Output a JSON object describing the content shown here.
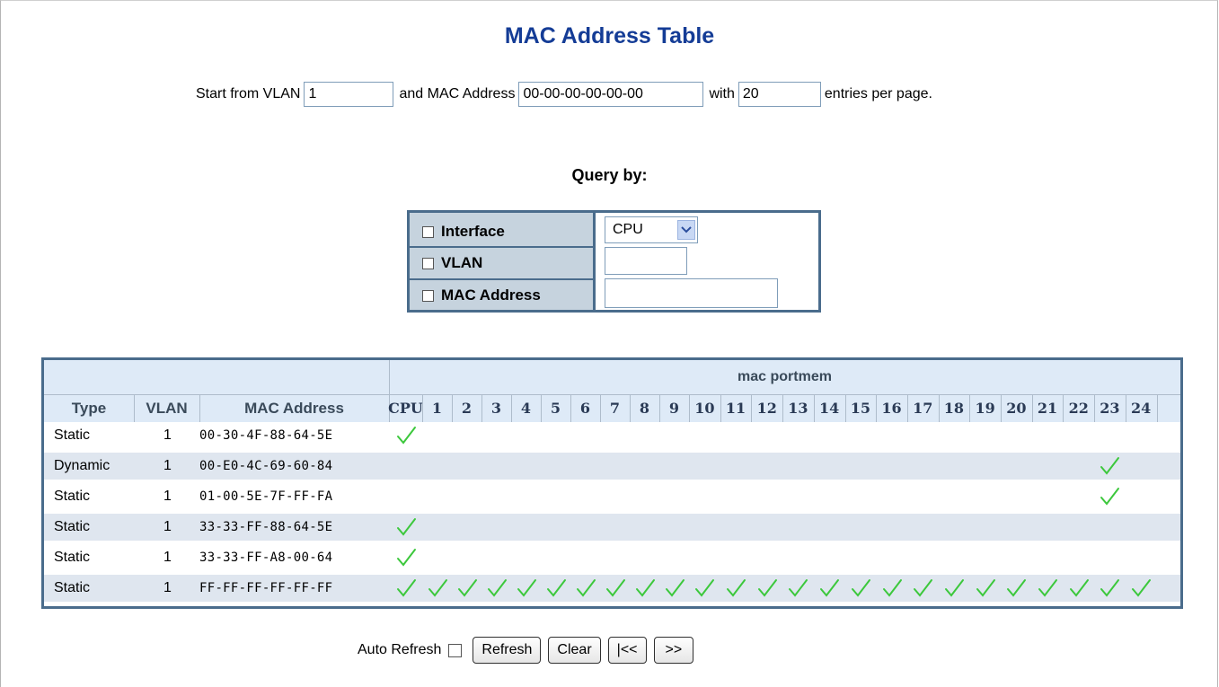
{
  "title": "MAC Address Table",
  "start": {
    "label_start": "Start from VLAN",
    "vlan_value": "1",
    "label_mac": "and MAC Address",
    "mac_value": "00-00-00-00-00-00",
    "label_with": "with",
    "entries_value": "20",
    "label_entries": "entries per page."
  },
  "query": {
    "heading": "Query by:",
    "interface_label": "Interface",
    "interface_value": "CPU",
    "vlan_label": "VLAN",
    "vlan_value": "",
    "mac_label": "MAC Address",
    "mac_value": ""
  },
  "table": {
    "group_header": "mac portmem",
    "col_type": "Type",
    "col_vlan": "VLAN",
    "col_mac": "MAC Address",
    "ports": [
      "CPU",
      "1",
      "2",
      "3",
      "4",
      "5",
      "6",
      "7",
      "8",
      "9",
      "10",
      "11",
      "12",
      "13",
      "14",
      "15",
      "16",
      "17",
      "18",
      "19",
      "20",
      "21",
      "22",
      "23",
      "24"
    ],
    "rows": [
      {
        "type": "Static",
        "vlan": "1",
        "mac": "00-30-4F-88-64-5E",
        "members": [
          "CPU"
        ]
      },
      {
        "type": "Dynamic",
        "vlan": "1",
        "mac": "00-E0-4C-69-60-84",
        "members": [
          "23"
        ]
      },
      {
        "type": "Static",
        "vlan": "1",
        "mac": "01-00-5E-7F-FF-FA",
        "members": [
          "23"
        ]
      },
      {
        "type": "Static",
        "vlan": "1",
        "mac": "33-33-FF-88-64-5E",
        "members": [
          "CPU"
        ]
      },
      {
        "type": "Static",
        "vlan": "1",
        "mac": "33-33-FF-A8-00-64",
        "members": [
          "CPU"
        ]
      },
      {
        "type": "Static",
        "vlan": "1",
        "mac": "FF-FF-FF-FF-FF-FF",
        "members": [
          "CPU",
          "1",
          "2",
          "3",
          "4",
          "5",
          "6",
          "7",
          "8",
          "9",
          "10",
          "11",
          "12",
          "13",
          "14",
          "15",
          "16",
          "17",
          "18",
          "19",
          "20",
          "21",
          "22",
          "23",
          "24"
        ]
      }
    ],
    "check_color": "#3cc83c"
  },
  "footer": {
    "auto_refresh_label": "Auto Refresh",
    "refresh_label": "Refresh",
    "clear_label": "Clear",
    "first_label": "|<<",
    "next_label": ">>"
  }
}
